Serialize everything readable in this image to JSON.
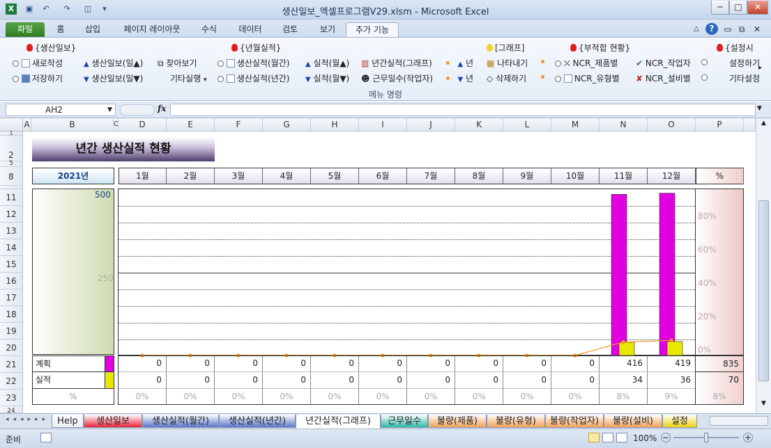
{
  "window": {
    "title": "생산일보_엑셀프로그램V29.xlsm  -  Microsoft Excel",
    "controls": [
      "─",
      "□",
      "✕"
    ]
  },
  "ribbon_tabs": [
    "파일",
    "홈",
    "삽입",
    "페이지 레이아웃",
    "수식",
    "데이터",
    "검토",
    "보기",
    "추가 기능"
  ],
  "ribbon": {
    "groups": [
      {
        "title": "{생산일보}",
        "items": [
          "새로작성",
          "저장하기",
          "생산일보(일▲)",
          "생산일보(일▼)",
          "찾아보기",
          "기타실행"
        ]
      },
      {
        "title": "{년월실적}",
        "items": [
          "생산실적(월간)",
          "생산실적(년간)",
          "실적(월▲)",
          "실적(월▼)",
          "년간실적(그래프)",
          "근무일수(작업자)",
          "년",
          "년"
        ]
      },
      {
        "title": "[그래프]",
        "items": [
          "나타내기",
          "삭제하기"
        ]
      },
      {
        "title": "{부적합 현황}",
        "items": [
          "NCR_제품별",
          "NCR_유형별",
          "NCR_작업자",
          "NCR_설비별"
        ]
      },
      {
        "title": "{설정시",
        "items": [
          "설정하기",
          "기타설정"
        ]
      }
    ],
    "group_label": "메뉴 명령"
  },
  "formula_bar": {
    "name_box": "AH2",
    "fx": "fx",
    "formula": ""
  },
  "columns": [
    "A",
    "B",
    "C",
    "D",
    "E",
    "F",
    "G",
    "H",
    "I",
    "J",
    "K",
    "L",
    "M",
    "N",
    "O",
    "P"
  ],
  "rows": [
    "1",
    "2",
    "5",
    "8",
    "11",
    "12",
    "13",
    "14",
    "15",
    "16",
    "17",
    "18",
    "19",
    "20",
    "21",
    "22",
    "23",
    "24"
  ],
  "report": {
    "title": "년간 생산실적 현황",
    "year": "2021년",
    "months": [
      "1월",
      "2월",
      "3월",
      "4월",
      "5월",
      "6월",
      "7월",
      "8월",
      "9월",
      "10월",
      "11월",
      "12월"
    ],
    "pct_header": "%",
    "row_plan_label": "계획",
    "row_actual_label": "실적",
    "row_pct_label": "%",
    "plan": [
      "0",
      "0",
      "0",
      "0",
      "0",
      "0",
      "0",
      "0",
      "0",
      "0",
      "416",
      "419"
    ],
    "plan_total": "835",
    "actual": [
      "0",
      "0",
      "0",
      "0",
      "0",
      "0",
      "0",
      "0",
      "0",
      "0",
      "34",
      "36"
    ],
    "actual_total": "70",
    "pct": [
      "0%",
      "0%",
      "0%",
      "0%",
      "0%",
      "0%",
      "0%",
      "0%",
      "0%",
      "0%",
      "8%",
      "9%"
    ],
    "pct_total": "8%"
  },
  "chart_data": {
    "type": "bar",
    "categories": [
      "1월",
      "2월",
      "3월",
      "4월",
      "5월",
      "6월",
      "7월",
      "8월",
      "9월",
      "10월",
      "11월",
      "12월"
    ],
    "series": [
      {
        "name": "계획",
        "values": [
          0,
          0,
          0,
          0,
          0,
          0,
          0,
          0,
          0,
          0,
          416,
          419
        ],
        "color": "#e000e0"
      },
      {
        "name": "실적",
        "values": [
          0,
          0,
          0,
          0,
          0,
          0,
          0,
          0,
          0,
          0,
          34,
          36
        ],
        "color": "#e8e800"
      }
    ],
    "line": {
      "values": [
        0,
        0,
        0,
        0,
        0,
        0,
        0,
        0,
        0,
        0,
        8,
        9
      ],
      "color": "#f29a1c",
      "axis": "right"
    },
    "ylim": [
      0,
      500
    ],
    "y_ticks": [
      "500",
      "250"
    ],
    "y2_ticks": [
      "80%",
      "60%",
      "40%",
      "20%",
      "0%"
    ],
    "y2lim": [
      0,
      100
    ]
  },
  "sheet_tabs": [
    "Help",
    "생산일보",
    "생산실적(월간)",
    "생산실적(년간)",
    "년간실적(그래프)",
    "근무일수",
    "불량(제품)",
    "불량(유형)",
    "불량(작업자)",
    "불량(설비)",
    "설정"
  ],
  "sheet_tab_colors": [
    "#e9eef6",
    "#e8243a",
    "#5a76c8",
    "#5a76c8",
    "#ffffff",
    "#2fb9a6",
    "#f2a15a",
    "#f2a15a",
    "#f2a15a",
    "#f2a15a",
    "#f0d010"
  ],
  "status": {
    "ready": "준비",
    "zoom": "100%"
  }
}
